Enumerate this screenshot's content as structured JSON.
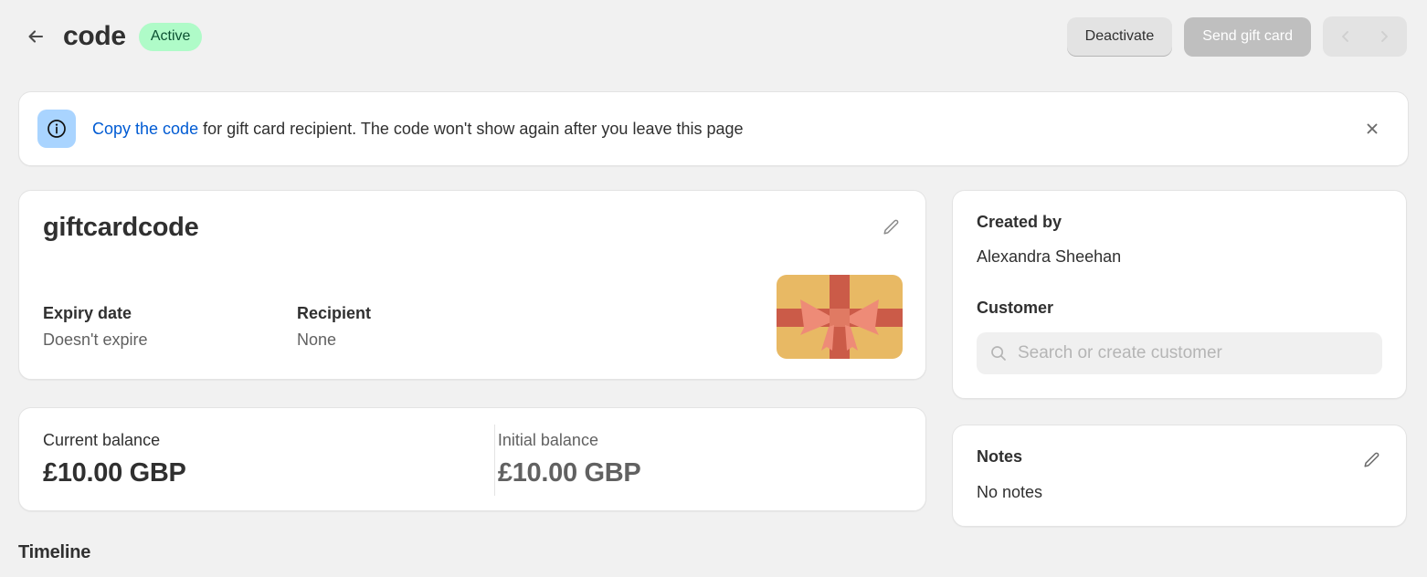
{
  "header": {
    "back_icon": "arrow-left-icon",
    "title": "code",
    "status_badge": "Active",
    "status_badge_bg": "#affbc8",
    "status_badge_color": "#0c5132",
    "deactivate_label": "Deactivate",
    "send_gift_card_label": "Send gift card",
    "prev_icon": "chevron-left-icon",
    "next_icon": "chevron-right-icon"
  },
  "banner": {
    "icon": "info-circle-icon",
    "icon_bg": "#a9d4ff",
    "link_text": "Copy the code",
    "rest_text": " for gift card recipient. The code won't show again after you leave this page",
    "close_icon": "close-icon",
    "link_color": "#005bd3"
  },
  "gift_card": {
    "code": "giftcardcode",
    "edit_icon": "pencil-icon",
    "fields": [
      {
        "label": "Expiry date",
        "value": "Doesn't expire"
      },
      {
        "label": "Recipient",
        "value": "None"
      }
    ],
    "illustration": "gift-card-icon",
    "illustration_colors": {
      "card": "#e8b964",
      "ribbon": "#cb5b48",
      "bow": "#ee8b77"
    }
  },
  "balance": {
    "current_label": "Current balance",
    "current_value": "£10.00 GBP",
    "initial_label": "Initial balance",
    "initial_value": "£10.00 GBP"
  },
  "timeline": {
    "heading": "Timeline"
  },
  "sidebar": {
    "created_by_label": "Created by",
    "created_by_value": "Alexandra Sheehan",
    "customer_label": "Customer",
    "customer_search_placeholder": "Search or create customer",
    "customer_search_value": "",
    "search_icon": "search-icon",
    "notes_label": "Notes",
    "notes_value": "No notes",
    "notes_edit_icon": "pencil-icon"
  }
}
